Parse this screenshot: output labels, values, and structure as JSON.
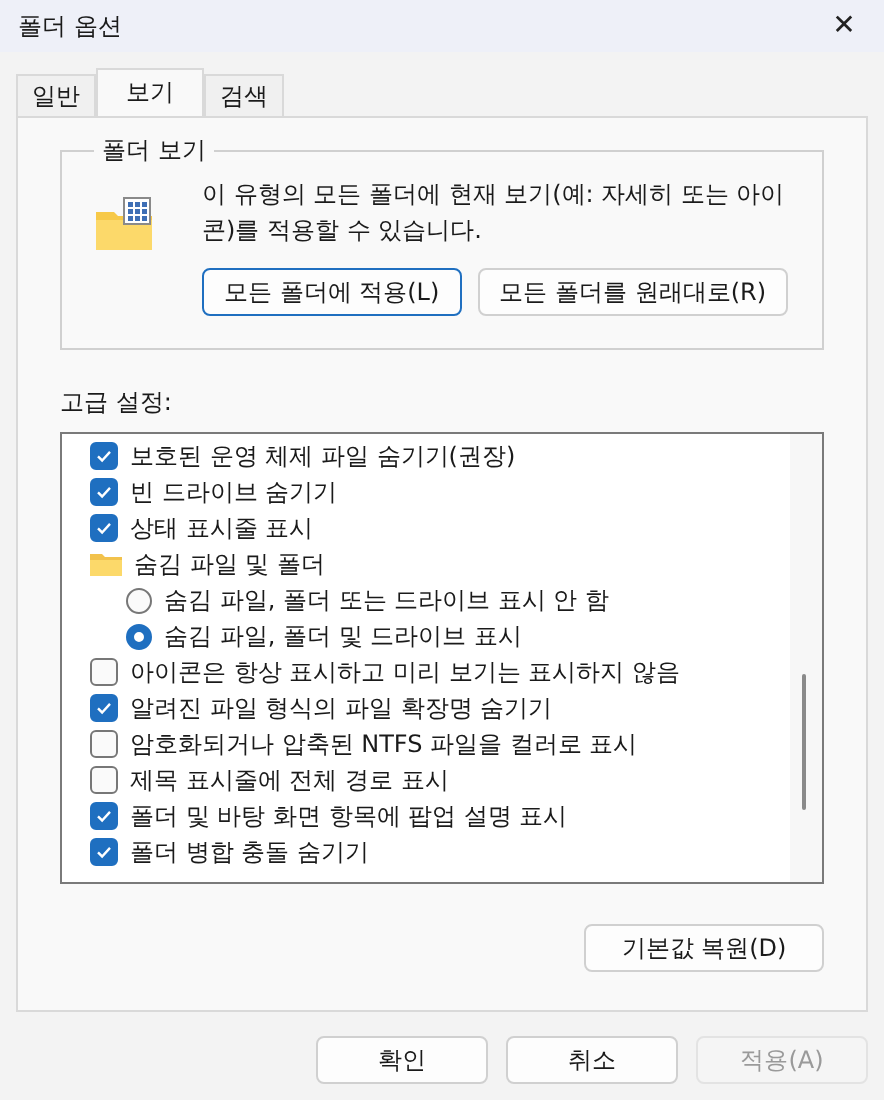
{
  "window": {
    "title": "폴더 옵션",
    "close": "✕"
  },
  "tabs": [
    {
      "label": "일반",
      "selected": false
    },
    {
      "label": "보기",
      "selected": true
    },
    {
      "label": "검색",
      "selected": false
    }
  ],
  "folder_views": {
    "title": "폴더 보기",
    "description": "이 유형의 모든 폴더에 현재 보기(예: 자세히 또는 아이콘)를 적용할 수 있습니다.",
    "buttons": [
      {
        "label": "모든 폴더에 적용(L)",
        "selected": true
      },
      {
        "label": "모든 폴더를 원래대로(R)",
        "selected": false
      }
    ]
  },
  "advanced": {
    "label": "고급 설정:",
    "items": [
      {
        "kind": "check",
        "label": "보호된 운영 체제 파일 숨기기(권장)",
        "checked": true
      },
      {
        "kind": "check",
        "label": "빈 드라이브 숨기기",
        "checked": true
      },
      {
        "kind": "check",
        "label": "상태 표시줄 표시",
        "checked": true
      },
      {
        "kind": "folder",
        "label": "숨김 파일 및 폴더",
        "children": [
          {
            "kind": "radio",
            "label": "숨김 파일, 폴더 또는 드라이브 표시 안 함",
            "selected": false
          },
          {
            "kind": "radio",
            "label": "숨김 파일, 폴더 및 드라이브 표시",
            "selected": true
          }
        ]
      },
      {
        "kind": "check",
        "label": "아이콘은 항상 표시하고 미리 보기는 표시하지 않음",
        "checked": false
      },
      {
        "kind": "check",
        "label": "알려진 파일 형식의 파일 확장명 숨기기",
        "checked": true
      },
      {
        "kind": "check",
        "label": "암호화되거나 압축된 NTFS 파일을 컬러로 표시",
        "checked": false
      },
      {
        "kind": "check",
        "label": "제목 표시줄에 전체 경로 표시",
        "checked": false
      },
      {
        "kind": "check",
        "label": "폴더 및 바탕 화면 항목에 팝업 설명 표시",
        "checked": true
      },
      {
        "kind": "check",
        "label": "폴더 병합 충돌 숨기기",
        "checked": true
      }
    ],
    "restore_button": "기본값 복원(D)"
  },
  "footer_buttons": [
    {
      "label": "확인",
      "disabled": false
    },
    {
      "label": "취소",
      "disabled": false
    },
    {
      "label": "적용(A)",
      "disabled": true
    }
  ]
}
